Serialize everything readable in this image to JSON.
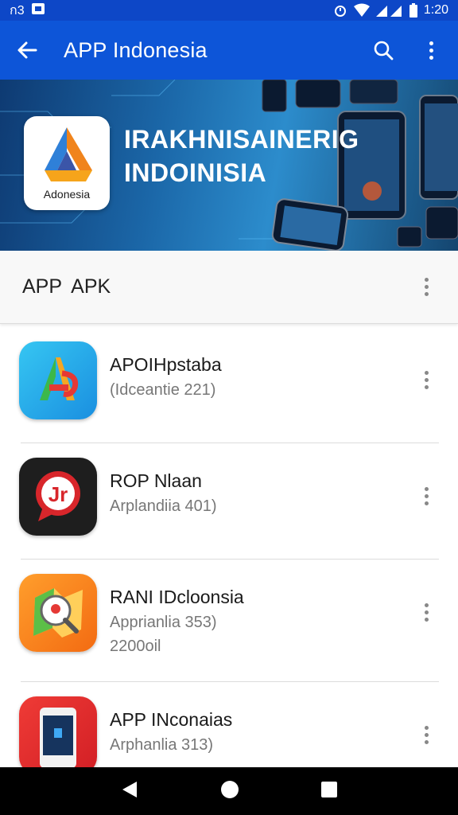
{
  "status_bar": {
    "left_text": "ก3",
    "time": "1:20"
  },
  "app_bar": {
    "title": "APP Indonesia"
  },
  "banner": {
    "logo_text": "Adonesia",
    "title_line1": "IRAKHNISAINERIG",
    "title_line2": "INDOINISIA"
  },
  "section": {
    "title": "APP  APK"
  },
  "apps": [
    {
      "name": "APOIHpstaba",
      "subtitle": "(Idceantie 221)",
      "extra": ""
    },
    {
      "name": "ROP Nlaan",
      "subtitle": "Arplandiia 401)",
      "extra": ""
    },
    {
      "name": "RANI IDcloonsia",
      "subtitle": "Apprianlia 353)",
      "extra": "2200oil"
    },
    {
      "name": "APP INconaias",
      "subtitle": "Arphanlia 313)",
      "extra": ""
    }
  ],
  "colors": {
    "app_bar": "#0d55d8",
    "status_bar": "#0d47c7"
  }
}
